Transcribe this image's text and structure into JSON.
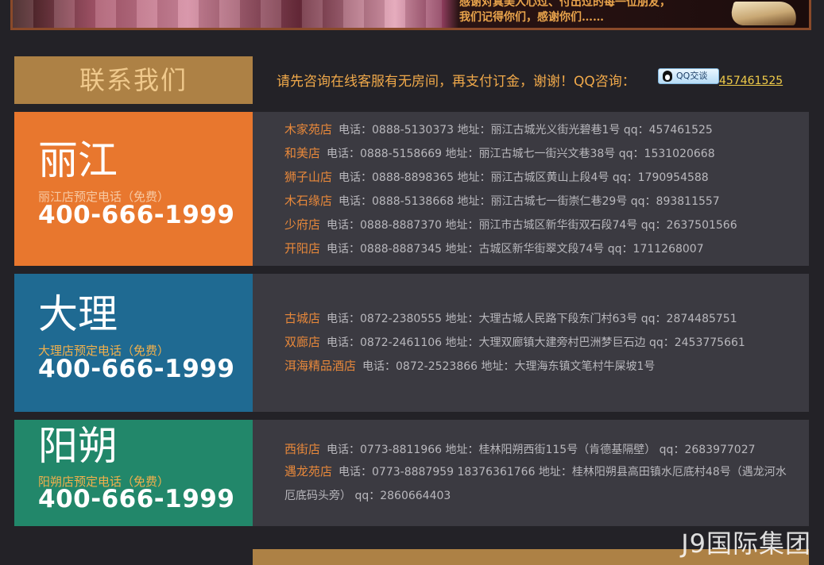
{
  "banner": {
    "line1": "感谢对真美人心过、付出过的每一位朋友，",
    "line2": "我们记得你们，感谢你们……"
  },
  "header": {
    "title": "联系我们",
    "notice": "请先咨询在线客服有无房间，再支付订金，谢谢！QQ咨询：",
    "qq_button": "QQ交谈",
    "qq_number": "457461525"
  },
  "cities": [
    {
      "name": "丽江",
      "subtitle": "丽江店预定电话（免费）",
      "phone": "400-666-1999",
      "color": "#e8772e",
      "subtitle_color": "#f7c9a3",
      "stores": [
        {
          "name": "木家苑店",
          "info": "电话：0888-5130373 地址：丽江古城光义街光碧巷1号 qq：457461525"
        },
        {
          "name": "和美店",
          "info": "电话：0888-5158669 地址：丽江古城七一街兴文巷38号 qq：1531020668"
        },
        {
          "name": "狮子山店",
          "info": "电话：0888-8898365 地址：丽江古城区黄山上段4号 qq：1790954588"
        },
        {
          "name": "木石缘店",
          "info": "电话：0888-5138668 地址：丽江古城七一街崇仁巷29号 qq：893811557"
        },
        {
          "name": "少府店",
          "info": "电话：0888-8887370  地址：丽江市古城区新华街双石段74号 qq：2637501566"
        },
        {
          "name": "开阳店",
          "info": "电话：0888-8887345  地址：古城区新华街翠文段74号 qq：1711268007"
        }
      ]
    },
    {
      "name": "大理",
      "subtitle": "大理店预定电话（免费）",
      "phone": "400-666-1999",
      "color": "#1f6a92",
      "subtitle_color": "#f1b04c",
      "stores": [
        {
          "name": "古城店",
          "info": "电话：0872-2380555 地址：大理古城人民路下段东门村63号 qq：2874485751"
        },
        {
          "name": "双廊店",
          "info": "电话：0872-2461106 地址：大理双廊镇大建旁村巴洲梦巨石边 qq：2453775661"
        },
        {
          "name": "洱海精品酒店",
          "info": "电话：0872-2523866 地址：大理海东镇文笔村牛屎坡1号"
        }
      ]
    },
    {
      "name": "阳朔",
      "subtitle": "阳朔店预定电话（免费）",
      "phone": "400-666-1999",
      "color": "#22876a",
      "subtitle_color": "#f1b04c",
      "stores": [
        {
          "name": "西街店",
          "info": "电话：0773-8811966 地址：桂林阳朔西街115号（肯德基隔壁） qq：2683977027"
        },
        {
          "name": "遇龙苑店",
          "info": "电话：0773-8887959 18376361766  地址：桂林阳朔县高田镇水厄底村48号（遇龙河水厄底码头旁） qq：2860664403"
        }
      ]
    }
  ],
  "watermark": "J9国际集团"
}
